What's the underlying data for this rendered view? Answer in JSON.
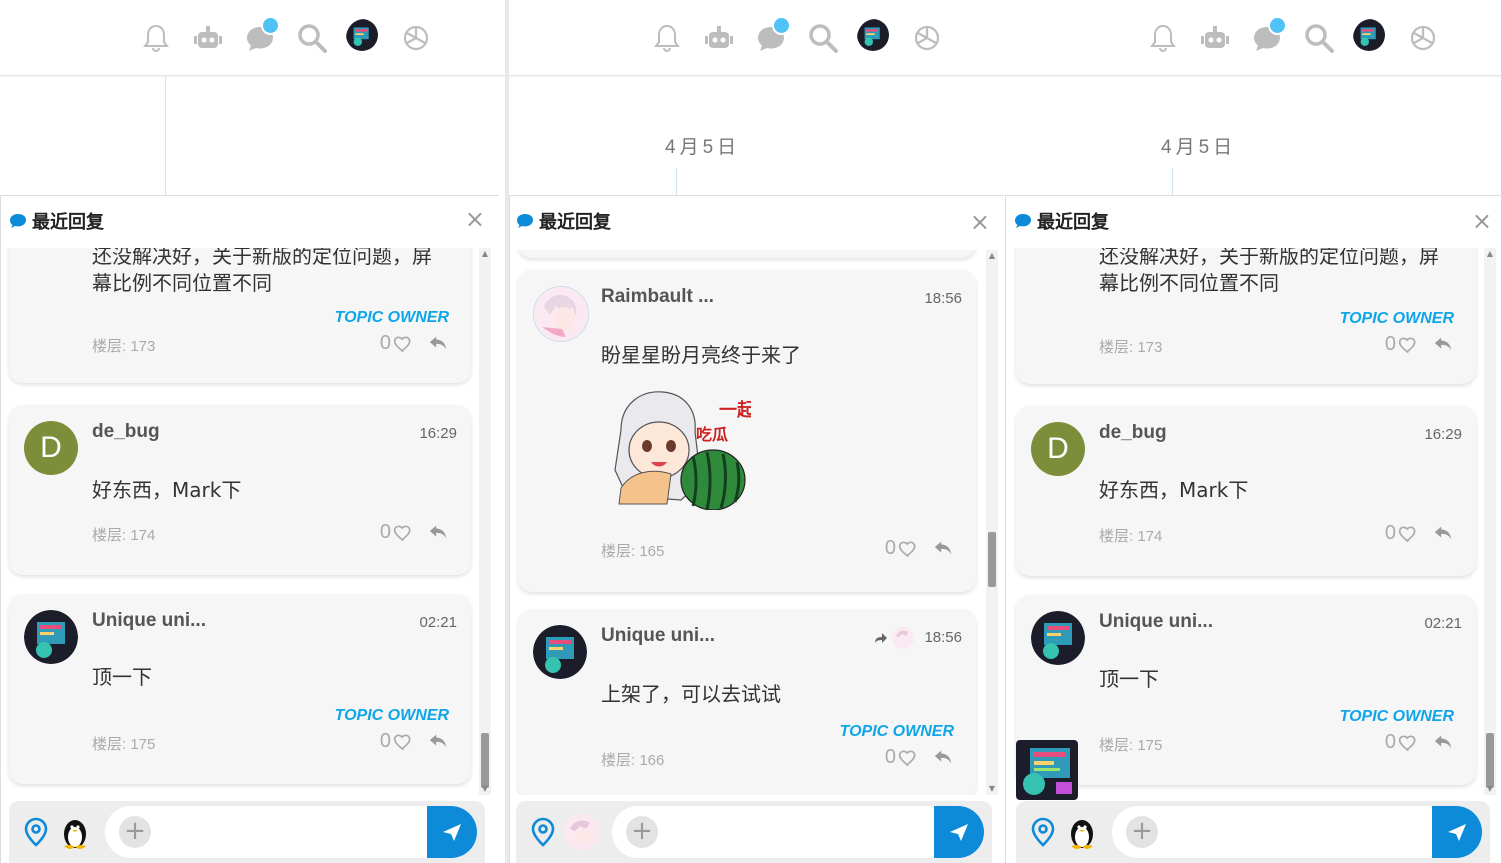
{
  "date_label": "4月5日",
  "sheet_title": "最近回复",
  "close_symbol": "×",
  "accent_color": "#0d8ad8",
  "badge_color": "#4fc3f7",
  "owner_color": "#0ea5e9",
  "owner_label": "TOPIC OWNER",
  "panel_left": {
    "card1": {
      "msg_line1": "还没解决好，关于新版的定位问题，屏",
      "msg_line2": "幕比例不同位置不同",
      "floor": "楼层: 173",
      "likes": "0"
    },
    "card2": {
      "avatar_letter": "D",
      "name": "de_bug",
      "time": "16:29",
      "msg": "好东西，Mark下",
      "floor": "楼层: 174",
      "likes": "0"
    },
    "card3": {
      "name": "Unique uni...",
      "time": "02:21",
      "msg": "顶一下",
      "floor": "楼层: 175",
      "likes": "0"
    }
  },
  "panel_mid": {
    "card1": {
      "name": "Raimbault ...",
      "time": "18:56",
      "msg": "盼星星盼月亮终于来了",
      "sticker_text": "一起吃瓜",
      "floor": "楼层: 165",
      "likes": "0"
    },
    "card2": {
      "name": "Unique uni...",
      "time": "18:56",
      "msg": "上架了，可以去试试",
      "floor": "楼层: 166",
      "likes": "0"
    }
  },
  "panel_right": {
    "card1": {
      "msg_line1": "还没解决好，关于新版的定位问题，屏",
      "msg_line2": "幕比例不同位置不同",
      "floor": "楼层: 173",
      "likes": "0"
    },
    "card2": {
      "avatar_letter": "D",
      "name": "de_bug",
      "time": "16:29",
      "msg": "好东西，Mark下",
      "floor": "楼层: 174",
      "likes": "0"
    },
    "card3": {
      "name": "Unique uni...",
      "time": "02:21",
      "msg": "顶一下",
      "floor": "楼层: 175",
      "likes": "0"
    }
  }
}
